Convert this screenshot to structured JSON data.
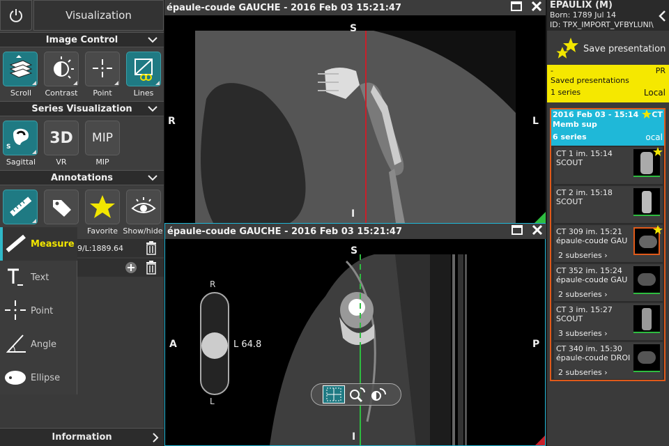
{
  "left": {
    "visualization_label": "Visualization",
    "image_control": {
      "title": "Image Control",
      "tools": [
        {
          "label": "Scroll",
          "icon": "scroll-stack-icon"
        },
        {
          "label": "Contrast",
          "icon": "contrast-icon"
        },
        {
          "label": "Point",
          "icon": "point-crosshair-icon"
        },
        {
          "label": "Lines",
          "icon": "lines-icon"
        }
      ]
    },
    "series_vis": {
      "title": "Series Visualization",
      "tools": [
        {
          "label": "Sagittal",
          "icon": "sagittal-icon",
          "badge": "S"
        },
        {
          "label": "VR",
          "icon_text": "3D"
        },
        {
          "label": "MIP",
          "icon_text": "MIP"
        }
      ]
    },
    "annotations": {
      "title": "Annotations",
      "tools": [
        {
          "label": "",
          "icon": "ruler-icon"
        },
        {
          "label": "",
          "icon": "tag-icon"
        },
        {
          "label": "Favorite",
          "icon": "star-icon"
        },
        {
          "label": "Show/hide",
          "icon": "eye-icon"
        }
      ],
      "menu": [
        {
          "label": "Measure",
          "icon": "measure-icon",
          "active": true
        },
        {
          "label": "Text",
          "icon": "text-icon"
        },
        {
          "label": "Point",
          "icon": "point-icon"
        },
        {
          "label": "Angle",
          "icon": "angle-icon"
        },
        {
          "label": "Ellipse",
          "icon": "ellipse-icon"
        }
      ],
      "wl_text": "9/L:1889.64"
    },
    "information_label": "Information"
  },
  "viewer_top": {
    "title": "épaule-coude GAUCHE - 2016 Feb 03 15:21:47",
    "orient": {
      "top": "S",
      "bottom": "I",
      "left": "R",
      "right": "L"
    }
  },
  "viewer_bottom": {
    "title": "épaule-coude GAUCHE - 2016 Feb 03 15:21:47",
    "orient": {
      "top": "S",
      "bottom": "I",
      "left": "A",
      "right": "P"
    },
    "slider": {
      "top": "R",
      "bottom": "L",
      "readout": "L 64.8"
    }
  },
  "right": {
    "patient": {
      "name": "EPAULIX (M)",
      "born": "Born: 1789 Jul 14",
      "id": "ID: TPX_IMPORT_VFBYLUNI\\"
    },
    "save_label": "Save presentation",
    "saved": {
      "dash": "-",
      "pr": "PR",
      "title": "Saved presentations",
      "count": "1 series",
      "local": "Local"
    },
    "study": {
      "date": "2016 Feb 03 - 15:14",
      "modality": "CT",
      "desc": "Memb sup",
      "count": "6 series",
      "local": "ocal"
    },
    "series": [
      {
        "line1": "CT 1 im. 15:14",
        "line2": "SCOUT",
        "subseries": "",
        "starred": true
      },
      {
        "line1": "CT 2 im. 15:18",
        "line2": "SCOUT",
        "subseries": "",
        "starred": false
      },
      {
        "line1": "CT 309 im. 15:21",
        "line2": "épaule-coude GAU",
        "subseries": "2 subseries",
        "starred": true
      },
      {
        "line1": "CT 352 im. 15:24",
        "line2": "épaule-coude GAU",
        "subseries": "2 subseries",
        "starred": false
      },
      {
        "line1": "CT 3 im. 15:27",
        "line2": "SCOUT",
        "subseries": "3 subseries",
        "starred": false
      },
      {
        "line1": "CT 340 im. 15:30",
        "line2": "épaule-coude DROI",
        "subseries": "2 subseries",
        "starred": false
      }
    ]
  }
}
